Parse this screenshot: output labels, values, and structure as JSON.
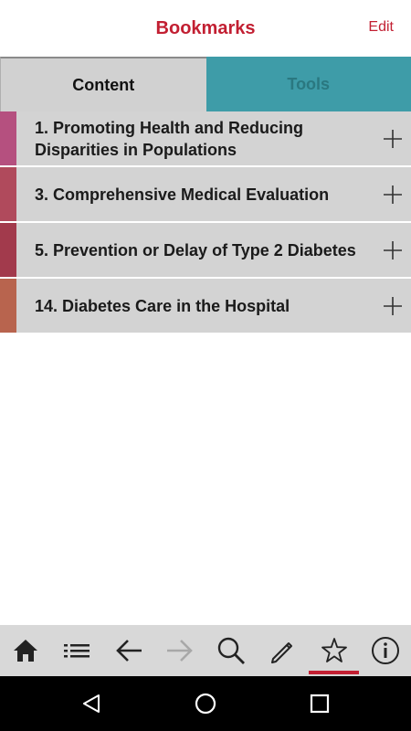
{
  "header": {
    "title": "Bookmarks",
    "edit_label": "Edit"
  },
  "tabs": [
    {
      "label": "Content",
      "active": true
    },
    {
      "label": "Tools",
      "active": false
    }
  ],
  "bookmarks": [
    {
      "label": "1. Promoting Health and Reducing Disparities in Populations",
      "color": "#b5507f"
    },
    {
      "label": "3. Comprehensive Medical Evaluation",
      "color": "#b04a5c"
    },
    {
      "label": "5. Prevention or Delay of Type 2 Diabetes",
      "color": "#a23a4c"
    },
    {
      "label": "14. Diabetes Care in the Hospital",
      "color": "#b8644e"
    }
  ],
  "toolbar": [
    {
      "name": "home-icon"
    },
    {
      "name": "list-icon"
    },
    {
      "name": "back-arrow-icon"
    },
    {
      "name": "forward-arrow-icon",
      "disabled": true
    },
    {
      "name": "search-icon"
    },
    {
      "name": "pencil-icon"
    },
    {
      "name": "star-icon",
      "active": true
    },
    {
      "name": "info-icon"
    }
  ],
  "system_nav": [
    "back-triangle-icon",
    "home-circle-icon",
    "recents-square-icon"
  ],
  "colors": {
    "accent": "#c21f32",
    "tools_tab": "#3e9ca8",
    "row_background": "#d3d3d3"
  }
}
